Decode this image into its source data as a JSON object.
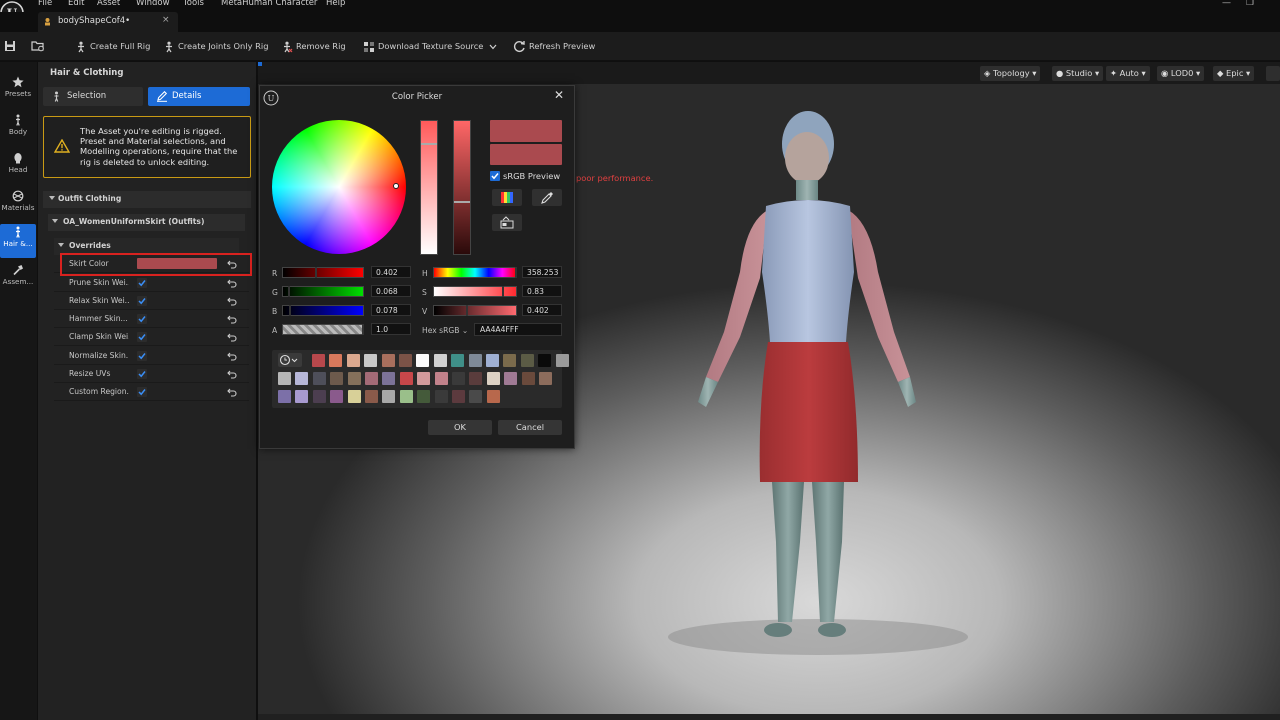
{
  "menu": [
    "File",
    "Edit",
    "Asset",
    "Window",
    "Tools",
    "MetaHuman Character",
    "Help"
  ],
  "tab": {
    "title": "bodyShapeCof4•",
    "close": "×"
  },
  "toolbar": {
    "create_full_rig": "Create Full Rig",
    "create_joints_only_rig": "Create Joints Only Rig",
    "remove_rig": "Remove Rig",
    "download_texture_source": "Download Texture Source",
    "refresh_preview": "Refresh Preview"
  },
  "modes": [
    {
      "label": "Presets",
      "icon": "star-icon"
    },
    {
      "label": "Body",
      "icon": "body-icon"
    },
    {
      "label": "Head",
      "icon": "head-icon"
    },
    {
      "label": "Materials",
      "icon": "materials-icon"
    },
    {
      "label": "Hair &...",
      "icon": "hair-icon"
    },
    {
      "label": "Assem...",
      "icon": "hammer-icon"
    }
  ],
  "panel": {
    "title": "Hair & Clothing",
    "selection_tab": "Selection",
    "details_tab": "Details",
    "warning": "The Asset you're editing is rigged. Preset and Material selections, and Modelling operations, require that the rig is deleted to unlock editing.",
    "section_outfit": "Outfit Clothing",
    "section_asset": "OA_WomenUniformSkirt (Outfits)",
    "section_overrides": "Overrides",
    "skirt_color_label": "Skirt Color",
    "skirt_color_value": "#aa4a4f",
    "rows": [
      {
        "label": "Prune Skin Wei...",
        "checked": true
      },
      {
        "label": "Relax Skin Wei...",
        "checked": true
      },
      {
        "label": "Hammer Skin...",
        "checked": true
      },
      {
        "label": "Clamp Skin Wei...",
        "checked": true
      },
      {
        "label": "Normalize Skin...",
        "checked": true
      },
      {
        "label": "Resize UVs",
        "checked": true
      },
      {
        "label": "Custom Region...",
        "checked": true
      }
    ]
  },
  "viewport": {
    "buttons": [
      "Topology",
      "Studio",
      "Auto",
      "LOD0",
      "Epic"
    ],
    "warning_text": "poor performance."
  },
  "picker": {
    "title": "Color Picker",
    "srgb_preview": "sRGB Preview",
    "labels": {
      "r": "R",
      "g": "G",
      "b": "B",
      "a": "A",
      "h": "H",
      "s": "S",
      "v": "V"
    },
    "values": {
      "r": "0.402",
      "g": "0.068",
      "b": "0.078",
      "a": "1.0",
      "h": "358.253",
      "s": "0.83",
      "v": "0.402"
    },
    "hex_label": "Hex sRGB",
    "hex_value": "AA4A4FFF",
    "ok": "OK",
    "cancel": "Cancel",
    "current_color": "#aa4a4f",
    "swatches": [
      "#b8484c",
      "#d9795c",
      "#dca98f",
      "#c9c9c9",
      "#a86f5d",
      "#7b5347",
      "#fbfbfb",
      "#d2d2d2",
      "#3f8f88",
      "#7f8a98",
      "#9fb0d3",
      "#7b6b4c",
      "#5b5b45",
      "#0a0a0a",
      "#9a9a9a",
      "#b7b7b7",
      "#b7b7d8",
      "#4e4f5a",
      "#6d5a4c",
      "#85705b",
      "#a46b77",
      "#7c7398",
      "#c8474a",
      "#d39a9c",
      "#c2828b",
      "#3a3a3a",
      "#5a3c3c",
      "#dcd1c4",
      "#a07a94",
      "#6a4a3c",
      "#8c6c5c",
      "#7c70a8",
      "#a89ad0",
      "#4c3e50",
      "#8a5a8c",
      "#d8d098",
      "#8a5a4a",
      "#a8a8a8",
      "#9abf8a",
      "#445a3a",
      "#3a3a3a",
      "#5c3a3e",
      "#4a4a4a",
      "#b8684c"
    ]
  }
}
